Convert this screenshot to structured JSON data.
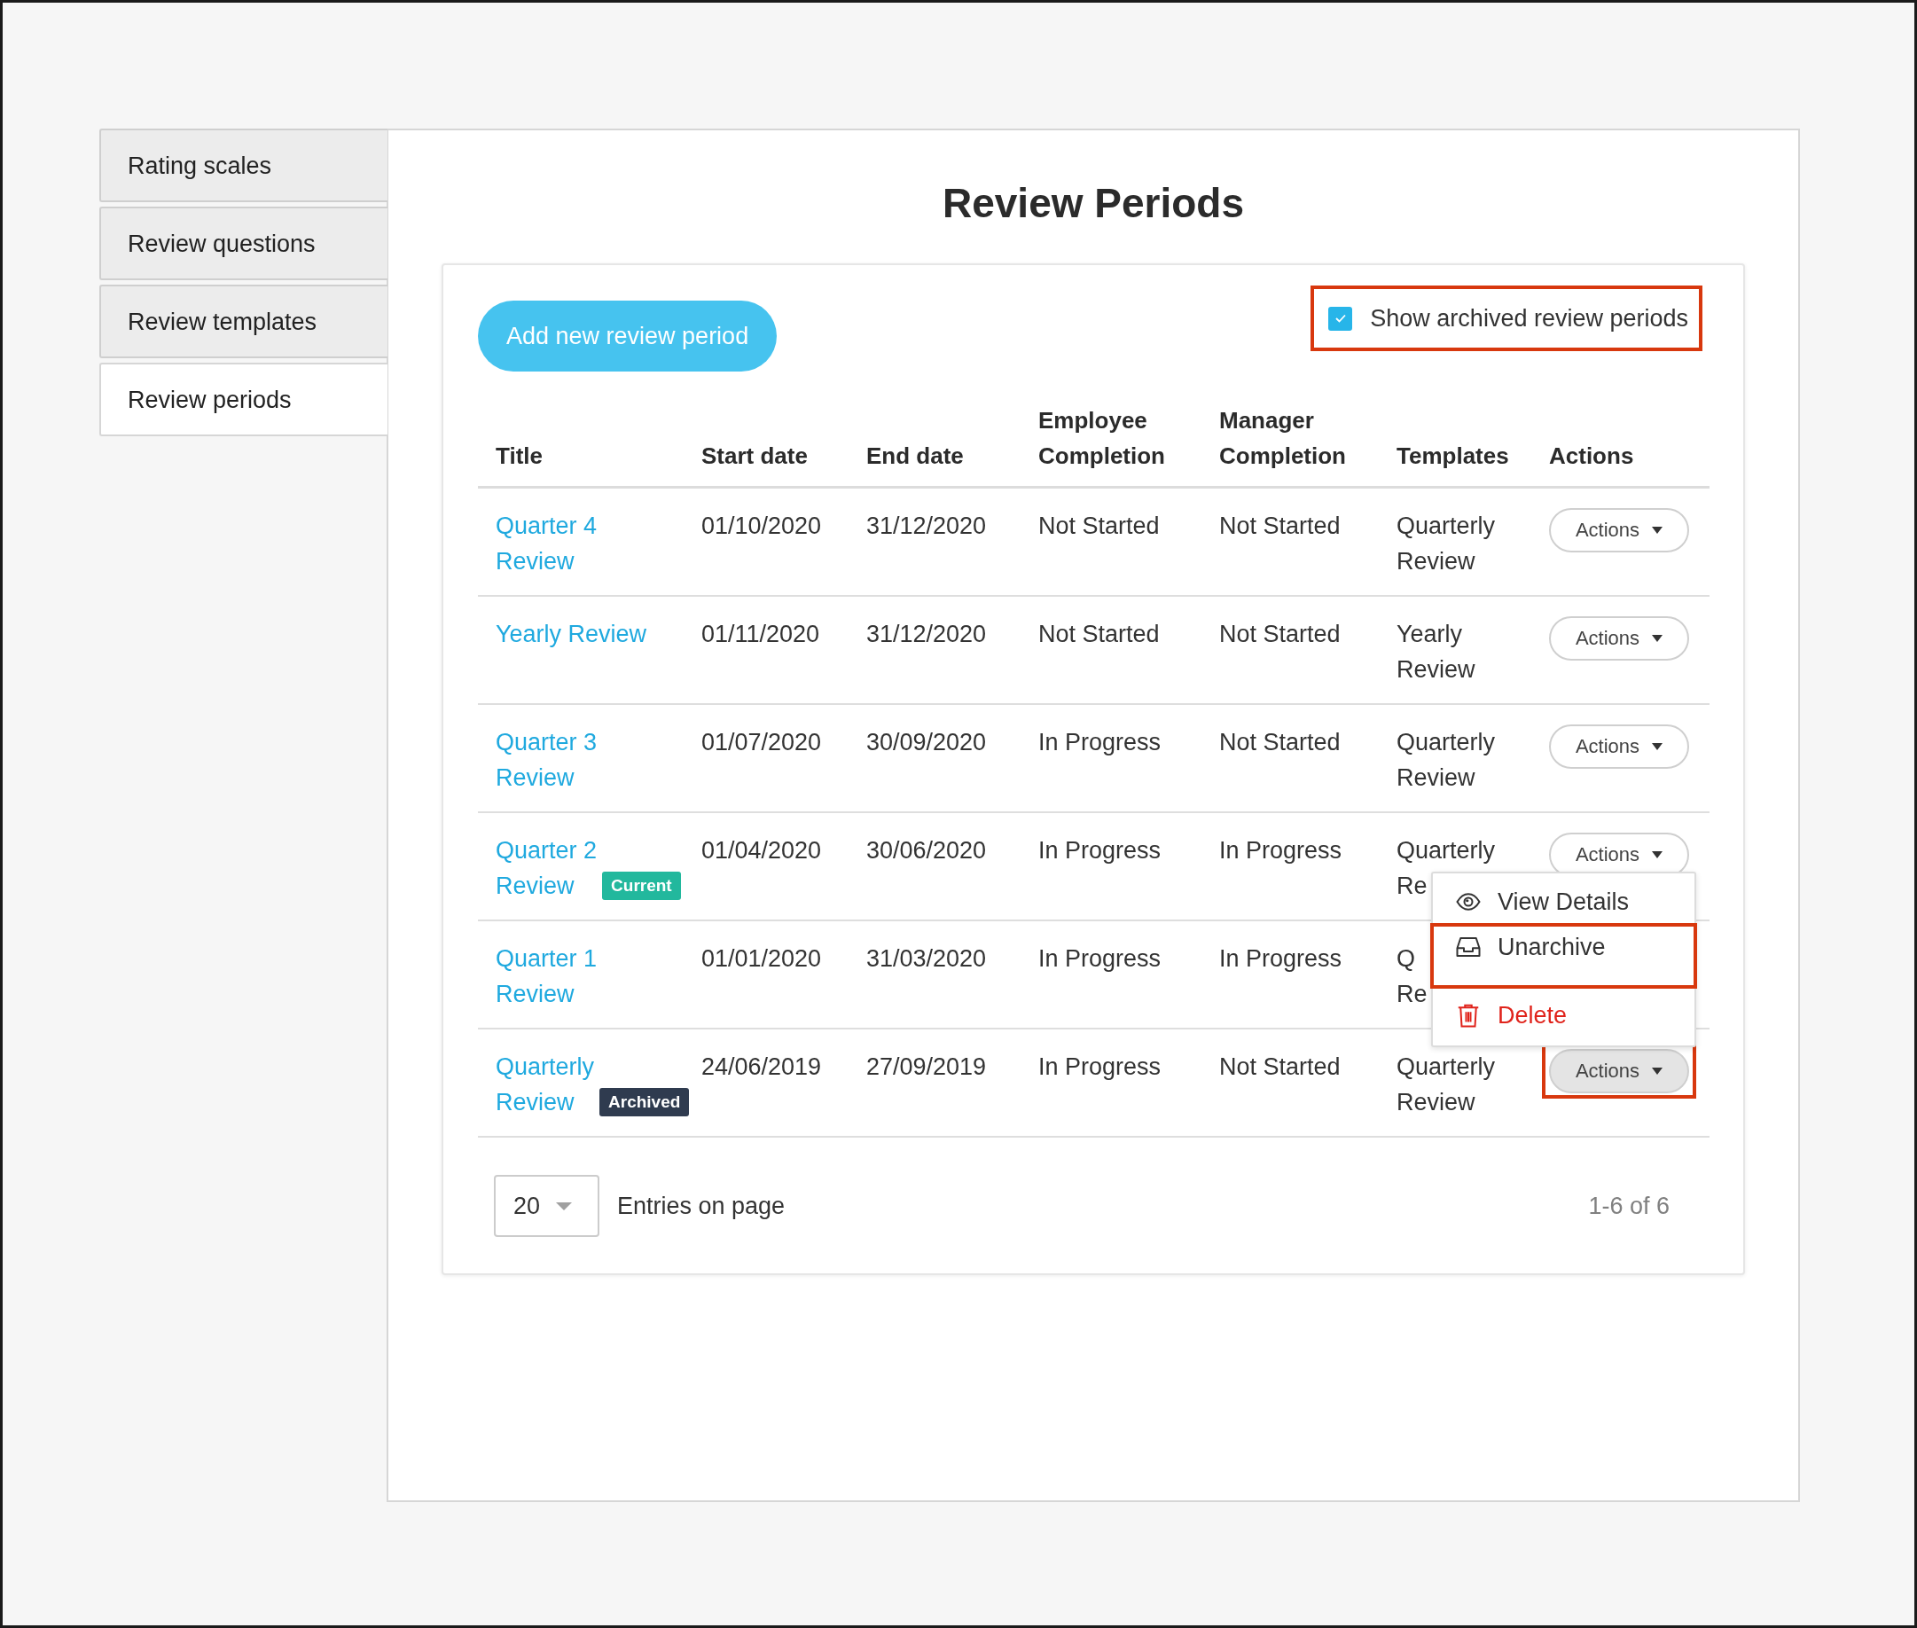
{
  "sidebar": {
    "items": [
      {
        "label": "Rating scales",
        "selected": false
      },
      {
        "label": "Review questions",
        "selected": false
      },
      {
        "label": "Review templates",
        "selected": false
      },
      {
        "label": "Review periods",
        "selected": true
      }
    ]
  },
  "page_title": "Review Periods",
  "add_button": "Add new review period",
  "archived_toggle": {
    "label": "Show archived review periods",
    "checked": true,
    "highlighted": true
  },
  "table": {
    "columns": [
      "Title",
      "Start date",
      "End date",
      "Employee Completion",
      "Manager Completion",
      "Templates",
      "Actions"
    ],
    "rows": [
      {
        "title": [
          "Quarter 4",
          "Review"
        ],
        "start_date": "01/10/2020",
        "end_date": "31/12/2020",
        "employee_completion": "Not Started",
        "manager_completion": "Not Started",
        "templates": [
          "Quarterly",
          "Review"
        ],
        "actions": {
          "label": "Actions",
          "pressed": false,
          "highlighted": false
        }
      },
      {
        "title": [
          "Yearly Review"
        ],
        "start_date": "01/11/2020",
        "end_date": "31/12/2020",
        "employee_completion": "Not Started",
        "manager_completion": "Not Started",
        "templates": [
          "Yearly",
          "Review"
        ],
        "actions": {
          "label": "Actions",
          "pressed": false,
          "highlighted": false
        }
      },
      {
        "title": [
          "Quarter 3",
          "Review"
        ],
        "start_date": "01/07/2020",
        "end_date": "30/09/2020",
        "employee_completion": "In Progress",
        "manager_completion": "Not Started",
        "templates": [
          "Quarterly",
          "Review"
        ],
        "actions": {
          "label": "Actions",
          "pressed": false,
          "highlighted": false
        }
      },
      {
        "title": [
          "Quarter 2",
          "Review"
        ],
        "badge": {
          "label": "Current",
          "kind": "current"
        },
        "start_date": "01/04/2020",
        "end_date": "30/06/2020",
        "employee_completion": "In Progress",
        "manager_completion": "In Progress",
        "templates": [
          "Quarterly",
          "Re"
        ],
        "actions": {
          "label": "Actions",
          "pressed": false,
          "highlighted": false
        },
        "menu": {
          "items": [
            {
              "label": "View Details",
              "kind": "view",
              "highlighted": false
            },
            {
              "label": "Unarchive",
              "kind": "unarchive",
              "highlighted": true
            },
            {
              "label": "Delete",
              "kind": "delete",
              "highlighted": false
            }
          ]
        }
      },
      {
        "title": [
          "Quarter 1",
          "Review"
        ],
        "start_date": "01/01/2020",
        "end_date": "31/03/2020",
        "employee_completion": "In Progress",
        "manager_completion": "In Progress",
        "templates": [
          "Q",
          "Re"
        ]
      },
      {
        "title": [
          "Quarterly",
          "Review"
        ],
        "badge": {
          "label": "Archived",
          "kind": "archived"
        },
        "start_date": "24/06/2019",
        "end_date": "27/09/2019",
        "employee_completion": "In Progress",
        "manager_completion": "Not Started",
        "templates": [
          "Quarterly",
          "Review"
        ],
        "actions": {
          "label": "Actions",
          "pressed": true,
          "highlighted": true
        }
      }
    ]
  },
  "footer": {
    "page_size": "20",
    "page_size_label": "Entries on page",
    "range": "1-6 of 6"
  }
}
